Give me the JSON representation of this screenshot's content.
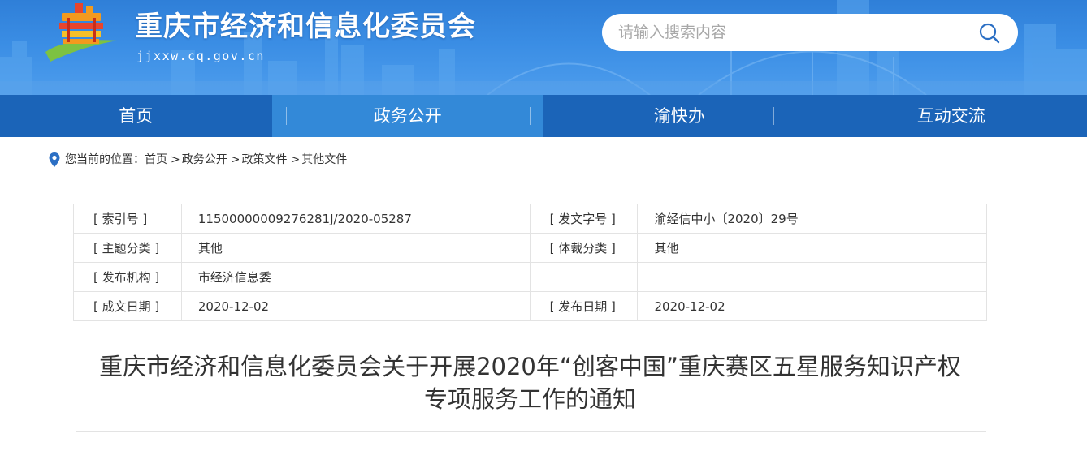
{
  "header": {
    "site_title": "重庆市经济和信息化委员会",
    "domain": "jjxxw.cq.gov.cn",
    "search": {
      "placeholder": "请输入搜索内容",
      "value": ""
    }
  },
  "nav": {
    "items": [
      {
        "label": "首页",
        "active": false
      },
      {
        "label": "政务公开",
        "active": true
      },
      {
        "label": "渝快办",
        "active": false
      },
      {
        "label": "互动交流",
        "active": false
      }
    ]
  },
  "breadcrumb": {
    "prefix": "您当前的位置：",
    "items": [
      "首页",
      "政务公开",
      "政策文件",
      "其他文件"
    ],
    "separator": ">"
  },
  "meta": {
    "rows": [
      [
        {
          "label": "[ 索引号 ]",
          "value": "11500000009276281J/2020-05287"
        },
        {
          "label": "[ 发文字号 ]",
          "value": "渝经信中小〔2020〕29号"
        }
      ],
      [
        {
          "label": "[ 主题分类 ]",
          "value": "其他"
        },
        {
          "label": "[ 体裁分类 ]",
          "value": "其他"
        }
      ],
      [
        {
          "label": "[ 发布机构 ]",
          "value": "市经济信息委"
        },
        {
          "label": "",
          "value": ""
        }
      ],
      [
        {
          "label": "[ 成文日期 ]",
          "value": "2020-12-02"
        },
        {
          "label": "[ 发布日期 ]",
          "value": "2020-12-02"
        }
      ]
    ]
  },
  "article": {
    "title_line1": "重庆市经济和信息化委员会关于开展2020年“创客中国”重庆赛区五星服务知识产权",
    "title_line2": "专项服务工作的通知"
  },
  "colors": {
    "header_blue": "#3a8de4",
    "nav_blue": "#1b64b8",
    "nav_active": "#3389d8"
  }
}
